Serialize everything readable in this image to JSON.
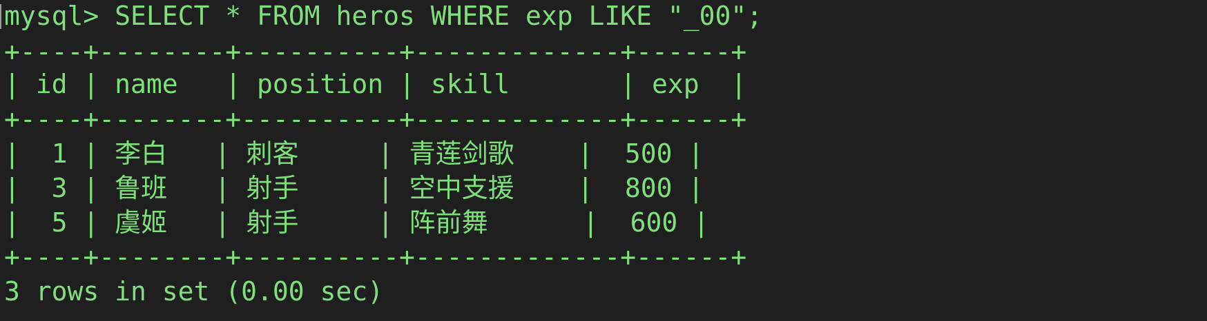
{
  "terminal": {
    "prompt": "mysql> ",
    "command": "SELECT * FROM heros WHERE exp LIKE \"_00\";",
    "border": "+----+--------+----------+-------------+------+",
    "header_row": "| id | name   | position | skill       | exp  |",
    "rows": [
      {
        "text": "|  1 | 李白   | 刺客     | 青莲剑歌    |  500 |"
      },
      {
        "text": "|  3 | 鲁班   | 射手     | 空中支援    |  800 |"
      },
      {
        "text": "|  5 | 虞姬   | 射手     | 阵前舞      |  600 |"
      }
    ],
    "footer": "3 rows in set (0.00 sec)"
  },
  "colors": {
    "background": "#1f1f1f",
    "text": "#7ee07a"
  }
}
